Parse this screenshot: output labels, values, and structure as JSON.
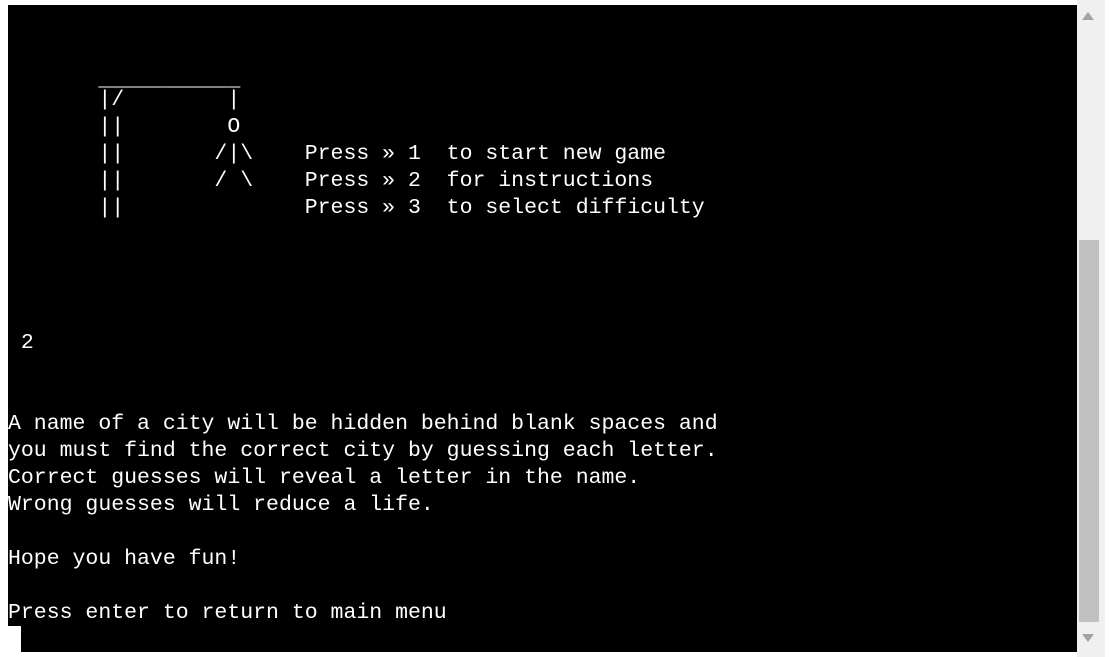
{
  "terminal": {
    "lines": [
      "",
      "",
      "       ___________",
      "       |/        |",
      "       ||        O",
      "       ||       /|\\    Press » 1  to start new game",
      "       ||       / \\    Press » 2  for instructions",
      "       ||              Press » 3  to select difficulty",
      "",
      "",
      "",
      "",
      " 2",
      "",
      "",
      "A name of a city will be hidden behind blank spaces and",
      "you must find the correct city by guessing each letter.",
      "Correct guesses will reveal a letter in the name.",
      "Wrong guesses will reduce a life.",
      "",
      "Hope you have fun!",
      "",
      "Press enter to return to main menu",
      ""
    ]
  },
  "scrollbar": {
    "up_icon": "triangle-up-icon",
    "down_icon": "triangle-down-icon"
  }
}
